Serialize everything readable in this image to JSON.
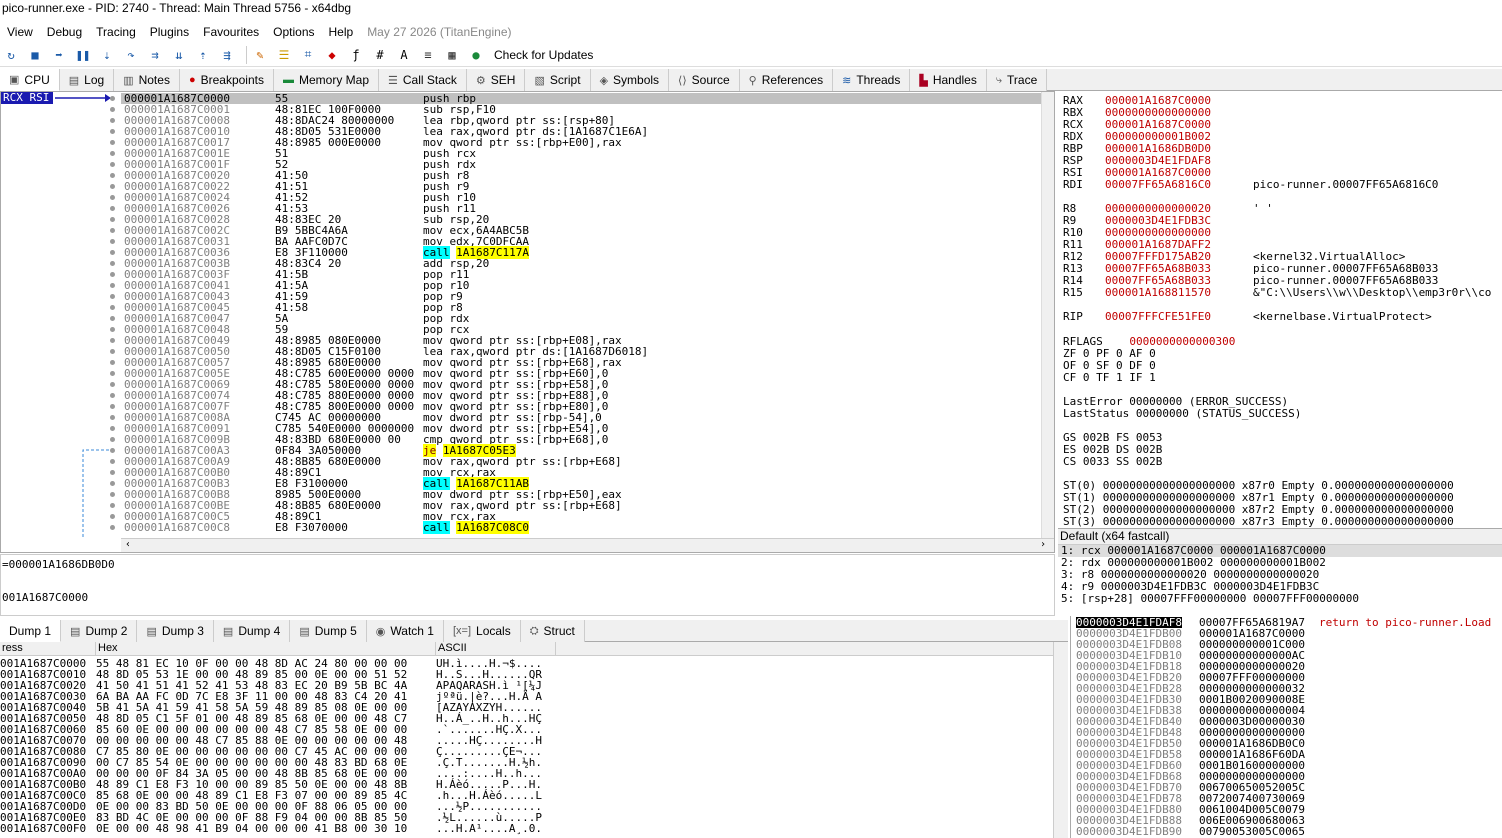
{
  "window": {
    "title": "pico-runner.exe - PID: 2740 - Thread: Main Thread 5756 - x64dbg"
  },
  "menu": [
    "View",
    "Debug",
    "Tracing",
    "Plugins",
    "Favourites",
    "Options",
    "Help"
  ],
  "menu_date": "May 27 2026 (TitanEngine)",
  "toolbar": {
    "check_updates": "Check for Updates"
  },
  "tabs": [
    "CPU",
    "Log",
    "Notes",
    "Breakpoints",
    "Memory Map",
    "Call Stack",
    "SEH",
    "Script",
    "Symbols",
    "Source",
    "References",
    "Threads",
    "Handles",
    "Trace"
  ],
  "cpu_label": "RCX RSI",
  "disasm": [
    {
      "a": "000001A1687C0000",
      "b": "55",
      "i": "push rbp"
    },
    {
      "a": "000001A1687C0001",
      "b": "48:81EC 100F0000",
      "i": "sub rsp,F10"
    },
    {
      "a": "000001A1687C0008",
      "b": "48:8DAC24 80000000",
      "i": "lea rbp,qword ptr ss:[rsp+80]"
    },
    {
      "a": "000001A1687C0010",
      "b": "48:8D05 531E0000",
      "i": "lea rax,qword ptr ds:[1A1687C1E6A]"
    },
    {
      "a": "000001A1687C0017",
      "b": "48:8985 000E0000",
      "i": "mov qword ptr ss:[rbp+E00],rax"
    },
    {
      "a": "000001A1687C001E",
      "b": "51",
      "i": "push rcx"
    },
    {
      "a": "000001A1687C001F",
      "b": "52",
      "i": "push rdx"
    },
    {
      "a": "000001A1687C0020",
      "b": "41:50",
      "i": "push r8"
    },
    {
      "a": "000001A1687C0022",
      "b": "41:51",
      "i": "push r9"
    },
    {
      "a": "000001A1687C0024",
      "b": "41:52",
      "i": "push r10"
    },
    {
      "a": "000001A1687C0026",
      "b": "41:53",
      "i": "push r11"
    },
    {
      "a": "000001A1687C0028",
      "b": "48:83EC 20",
      "i": "sub rsp,20"
    },
    {
      "a": "000001A1687C002C",
      "b": "B9 5BBC4A6A",
      "i": "mov ecx,6A4ABC5B"
    },
    {
      "a": "000001A1687C0031",
      "b": "BA AAFC0D7C",
      "i": "mov edx,7C0DFCAA"
    },
    {
      "a": "000001A1687C0036",
      "b": "E8 3F110000",
      "i": "call 1A1687C117A"
    },
    {
      "a": "000001A1687C003B",
      "b": "48:83C4 20",
      "i": "add rsp,20"
    },
    {
      "a": "000001A1687C003F",
      "b": "41:5B",
      "i": "pop r11"
    },
    {
      "a": "000001A1687C0041",
      "b": "41:5A",
      "i": "pop r10"
    },
    {
      "a": "000001A1687C0043",
      "b": "41:59",
      "i": "pop r9"
    },
    {
      "a": "000001A1687C0045",
      "b": "41:58",
      "i": "pop r8"
    },
    {
      "a": "000001A1687C0047",
      "b": "5A",
      "i": "pop rdx"
    },
    {
      "a": "000001A1687C0048",
      "b": "59",
      "i": "pop rcx"
    },
    {
      "a": "000001A1687C0049",
      "b": "48:8985 080E0000",
      "i": "mov qword ptr ss:[rbp+E08],rax"
    },
    {
      "a": "000001A1687C0050",
      "b": "48:8D05 C15F0100",
      "i": "lea rax,qword ptr ds:[1A1687D6018]"
    },
    {
      "a": "000001A1687C0057",
      "b": "48:8985 680E0000",
      "i": "mov qword ptr ss:[rbp+E68],rax"
    },
    {
      "a": "000001A1687C005E",
      "b": "48:C785 600E0000 0000",
      "i": "mov qword ptr ss:[rbp+E60],0"
    },
    {
      "a": "000001A1687C0069",
      "b": "48:C785 580E0000 0000",
      "i": "mov qword ptr ss:[rbp+E58],0"
    },
    {
      "a": "000001A1687C0074",
      "b": "48:C785 880E0000 0000",
      "i": "mov qword ptr ss:[rbp+E88],0"
    },
    {
      "a": "000001A1687C007F",
      "b": "48:C785 800E0000 0000",
      "i": "mov qword ptr ss:[rbp+E80],0"
    },
    {
      "a": "000001A1687C008A",
      "b": "C745 AC 00000000",
      "i": "mov dword ptr ss:[rbp-54],0"
    },
    {
      "a": "000001A1687C0091",
      "b": "C785 540E0000 0000000",
      "i": "mov dword ptr ss:[rbp+E54],0"
    },
    {
      "a": "000001A1687C009B",
      "b": "48:83BD 680E0000 00",
      "i": "cmp qword ptr ss:[rbp+E68],0"
    },
    {
      "a": "000001A1687C00A3",
      "b": "0F84 3A050000",
      "i": "je 1A1687C05E3"
    },
    {
      "a": "000001A1687C00A9",
      "b": "48:8B85 680E0000",
      "i": "mov rax,qword ptr ss:[rbp+E68]"
    },
    {
      "a": "000001A1687C00B0",
      "b": "48:89C1",
      "i": "mov rcx,rax"
    },
    {
      "a": "000001A1687C00B3",
      "b": "E8 F3100000",
      "i": "call 1A1687C11AB"
    },
    {
      "a": "000001A1687C00B8",
      "b": "8985 500E0000",
      "i": "mov dword ptr ss:[rbp+E50],eax"
    },
    {
      "a": "000001A1687C00BE",
      "b": "48:8B85 680E0000",
      "i": "mov rax,qword ptr ss:[rbp+E68]"
    },
    {
      "a": "000001A1687C00C5",
      "b": "48:89C1",
      "i": "mov rcx,rax"
    },
    {
      "a": "000001A1687C00C8",
      "b": "E8 F3070000",
      "i": "call 1A1687C08C0"
    }
  ],
  "info": {
    "line1": "=000001A1686DB0D0",
    "line2": "001A1687C0000"
  },
  "registers": [
    {
      "n": "RAX",
      "v": "000001A1687C0000",
      "c": ""
    },
    {
      "n": "RBX",
      "v": "0000000000000000",
      "c": ""
    },
    {
      "n": "RCX",
      "v": "000001A1687C0000",
      "c": ""
    },
    {
      "n": "RDX",
      "v": "000000000001B002",
      "c": ""
    },
    {
      "n": "RBP",
      "v": "000001A1686DB0D0",
      "c": ""
    },
    {
      "n": "RSP",
      "v": "0000003D4E1FDAF8",
      "c": ""
    },
    {
      "n": "RSI",
      "v": "000001A1687C0000",
      "c": ""
    },
    {
      "n": "RDI",
      "v": "00007FF65A6816C0",
      "c": "pico-runner.00007FF65A6816C0"
    },
    {
      "n": "",
      "v": "",
      "c": ""
    },
    {
      "n": "R8",
      "v": "0000000000000020",
      "c": "' '"
    },
    {
      "n": "R9",
      "v": "0000003D4E1FDB3C",
      "c": ""
    },
    {
      "n": "R10",
      "v": "0000000000000000",
      "c": ""
    },
    {
      "n": "R11",
      "v": "000001A1687DAFF2",
      "c": ""
    },
    {
      "n": "R12",
      "v": "00007FFFD175AB20",
      "c": "<kernel32.VirtualAlloc>"
    },
    {
      "n": "R13",
      "v": "00007FF65A68B033",
      "c": "pico-runner.00007FF65A68B033"
    },
    {
      "n": "R14",
      "v": "00007FF65A68B033",
      "c": "pico-runner.00007FF65A68B033"
    },
    {
      "n": "R15",
      "v": "000001A168811570",
      "c": "&\"C:\\\\Users\\\\w\\\\Desktop\\\\emp3r0r\\\\co"
    },
    {
      "n": "",
      "v": "",
      "c": ""
    },
    {
      "n": "RIP",
      "v": "00007FFFCFE51FE0",
      "c": "<kernelbase.VirtualProtect>"
    }
  ],
  "flags": {
    "rflags": "RFLAGS  0000000000000300",
    "l1": "ZF 0  PF 0  AF 0",
    "l2": "OF 0  SF 0  DF 0",
    "l3": "CF 0  TF 1  IF 1",
    "lasterror": "LastError  00000000 (ERROR_SUCCESS)",
    "laststatus": "LastStatus 00000000 (STATUS_SUCCESS)",
    "s1": "GS 002B  FS 0053",
    "s2": "ES 002B  DS 002B",
    "s3": "CS 0033  SS 002B",
    "st0": "ST(0) 00000000000000000000 x87r0 Empty 0.000000000000000000",
    "st1": "ST(1) 00000000000000000000 x87r1 Empty 0.000000000000000000",
    "st2": "ST(2) 00000000000000000000 x87r2 Empty 0.000000000000000000",
    "st3": "ST(3) 00000000000000000000 x87r3 Empty 0.000000000000000000"
  },
  "callconv": {
    "head": "Default (x64 fastcall)",
    "rows": [
      "1: rcx 000001A1687C0000 000001A1687C0000",
      "2: rdx 000000000001B002 000000000001B002",
      "3: r8 0000000000000020 0000000000000020",
      "4: r9 0000003D4E1FDB3C 0000003D4E1FDB3C",
      "5: [rsp+28] 00007FFF00000000 00007FFF00000000"
    ]
  },
  "dumptabs": [
    "Dump 1",
    "Dump 2",
    "Dump 3",
    "Dump 4",
    "Dump 5",
    "Watch 1",
    "Locals",
    "Struct"
  ],
  "dump_head": {
    "addr": "ress",
    "hex": "Hex",
    "ascii": "ASCII"
  },
  "dump": [
    {
      "a": "001A1687C0000",
      "h": "55 48 81 EC 10 0F 00 00 48 8D AC 24 80 00 00 00",
      "x": "UH.ì....H.¬$...."
    },
    {
      "a": "001A1687C0010",
      "h": "48 8D 05 53 1E 00 00 48 89 85 00 0E 00 00 51 52",
      "x": "H..S...H......QR"
    },
    {
      "a": "001A1687C0020",
      "h": "41 50 41 51 41 52 41 53 48 83 EC 20 B9 5B BC 4A",
      "x": "APAQARASH.ì ¹[¼J"
    },
    {
      "a": "001A1687C0030",
      "h": "6A BA AA FC 0D 7C E8 3F 11 00 00 48 83 C4 20 41",
      "x": "jºªü.|è?...H.Ä A"
    },
    {
      "a": "001A1687C0040",
      "h": "5B 41 5A 41 59 41 58 5A 59 48 89 85 08 0E 00 00",
      "x": "[AZAYAXZYH......"
    },
    {
      "a": "001A1687C0050",
      "h": "48 8D 05 C1 5F 01 00 48 89 85 68 0E 00 00 48 C7",
      "x": "H..Á_..H..h...HÇ"
    },
    {
      "a": "001A1687C0060",
      "h": "85 60 0E 00 00 00 00 00 00 48 C7 85 58 0E 00 00",
      "x": ".`.......HÇ.X..."
    },
    {
      "a": "001A1687C0070",
      "h": "00 00 00 00 00 48 C7 85 88 0E 00 00 00 00 00 48",
      "x": ".....HÇ........H"
    },
    {
      "a": "001A1687C0080",
      "h": "C7 85 80 0E 00 00 00 00 00 00 C7 45 AC 00 00 00",
      "x": "Ç.........ÇE¬..."
    },
    {
      "a": "001A1687C0090",
      "h": "00 C7 85 54 0E 00 00 00 00 00 00 48 83 BD 68 0E",
      "x": ".Ç.T.......H.½h."
    },
    {
      "a": "001A1687C00A0",
      "h": "00 00 00 0F 84 3A 05 00 00 48 8B 85 68 0E 00 00",
      "x": "....:....H..h..."
    },
    {
      "a": "001A1687C00B0",
      "h": "48 89 C1 E8 F3 10 00 00 89 85 50 0E 00 00 48 8B",
      "x": "H.Áèó.....P...H."
    },
    {
      "a": "001A1687C00C0",
      "h": "85 68 0E 00 00 48 89 C1 E8 F3 07 00 00 89 85 4C",
      "x": ".h...H.Áèó.....L"
    },
    {
      "a": "001A1687C00D0",
      "h": "0E 00 00 83 BD 50 0E 00 00 00 0F 88 06 05 00 00",
      "x": "...½P..........."
    },
    {
      "a": "001A1687C00E0",
      "h": "83 BD 4C 0E 00 00 00 0F 88 F9 04 00 00 8B 85 50",
      "x": ".½L......ù.....P"
    },
    {
      "a": "001A1687C00F0",
      "h": "0E 00 00 48 98 41 B9 04 00 00 00 41 B8 00 30 10",
      "x": "...H.A¹....A¸.0."
    }
  ],
  "stack": [
    {
      "a": "0000003D4E1FDAF8",
      "v": "00007FF65A6819A7",
      "c": "return to pico-runner.Load"
    },
    {
      "a": "0000003D4E1FDB00",
      "v": "000001A1687C0000",
      "c": ""
    },
    {
      "a": "0000003D4E1FDB08",
      "v": "000000000001C000",
      "c": ""
    },
    {
      "a": "0000003D4E1FDB10",
      "v": "00000000000000AC",
      "c": ""
    },
    {
      "a": "0000003D4E1FDB18",
      "v": "0000000000000020",
      "c": ""
    },
    {
      "a": "0000003D4E1FDB20",
      "v": "00007FFF00000000",
      "c": ""
    },
    {
      "a": "0000003D4E1FDB28",
      "v": "0000000000000032",
      "c": ""
    },
    {
      "a": "0000003D4E1FDB30",
      "v": "0001B0020090008E",
      "c": ""
    },
    {
      "a": "0000003D4E1FDB38",
      "v": "0000000000000004",
      "c": ""
    },
    {
      "a": "0000003D4E1FDB40",
      "v": "0000003D00000030",
      "c": ""
    },
    {
      "a": "0000003D4E1FDB48",
      "v": "0000000000000000",
      "c": ""
    },
    {
      "a": "0000003D4E1FDB50",
      "v": "000001A1686DB0C0",
      "c": ""
    },
    {
      "a": "0000003D4E1FDB58",
      "v": "000001A1686F60DA",
      "c": ""
    },
    {
      "a": "0000003D4E1FDB60",
      "v": "0001B01600000000",
      "c": ""
    },
    {
      "a": "0000003D4E1FDB68",
      "v": "0000000000000000",
      "c": ""
    },
    {
      "a": "0000003D4E1FDB70",
      "v": "006700650052005C",
      "c": ""
    },
    {
      "a": "0000003D4E1FDB78",
      "v": "0072007400730069",
      "c": ""
    },
    {
      "a": "0000003D4E1FDB80",
      "v": "0061004D005C0079",
      "c": ""
    },
    {
      "a": "0000003D4E1FDB88",
      "v": "006E006900680063",
      "c": ""
    },
    {
      "a": "0000003D4E1FDB90",
      "v": "00790053005C0065",
      "c": ""
    }
  ],
  "colors": {
    "accent": "#1a1ab0",
    "call_bg": "#00ffff",
    "jump_bg": "#ffff00",
    "reg_value": "#c00000"
  }
}
